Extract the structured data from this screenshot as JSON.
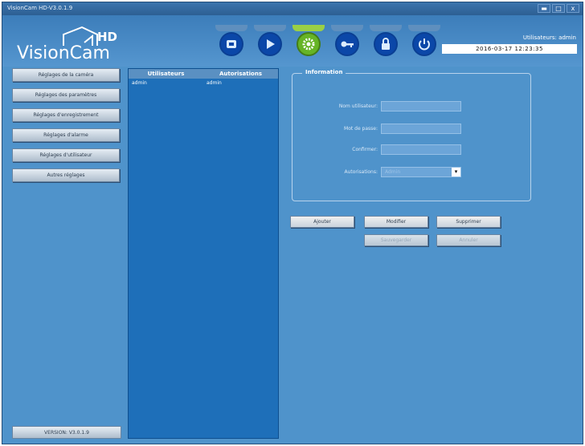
{
  "window": {
    "title": "VisionCam HD-V3.0.1.9",
    "minimize": "▬",
    "maximize": "□",
    "close": "x"
  },
  "logo": {
    "name": "VisionCam",
    "hd": "HD"
  },
  "header": {
    "user_text": "Utilisateurs: admin",
    "datetime": "2016-03-17  12:23:35"
  },
  "toolbar": [
    "camera-icon",
    "play-icon",
    "gear-icon",
    "key-icon",
    "lock-icon",
    "power-icon"
  ],
  "sidebar": {
    "items": [
      "Réglages de la caméra",
      "Réglages des paramètres",
      "Réglages d'enregistrement",
      "Réglages d'alarme",
      "Réglages d'utilisateur",
      "Autres réglages"
    ],
    "version": "VERSION: V3.0.1.9"
  },
  "userlist": {
    "headers": [
      "Utilisateurs",
      "Autorisations"
    ],
    "rows": [
      {
        "user": "admin",
        "perm": "admin"
      }
    ]
  },
  "info": {
    "legend": "Information",
    "fields": [
      "Nom utilisateur:",
      "Mot de passe:",
      "Confirmer:",
      "Autorisations:"
    ],
    "values": [
      "",
      "",
      "",
      "Admin"
    ]
  },
  "buttons": {
    "add": "Ajouter",
    "modify": "Modifier",
    "delete": "Supprimer",
    "save": "Sauvegarder",
    "cancel": "Annuler"
  }
}
